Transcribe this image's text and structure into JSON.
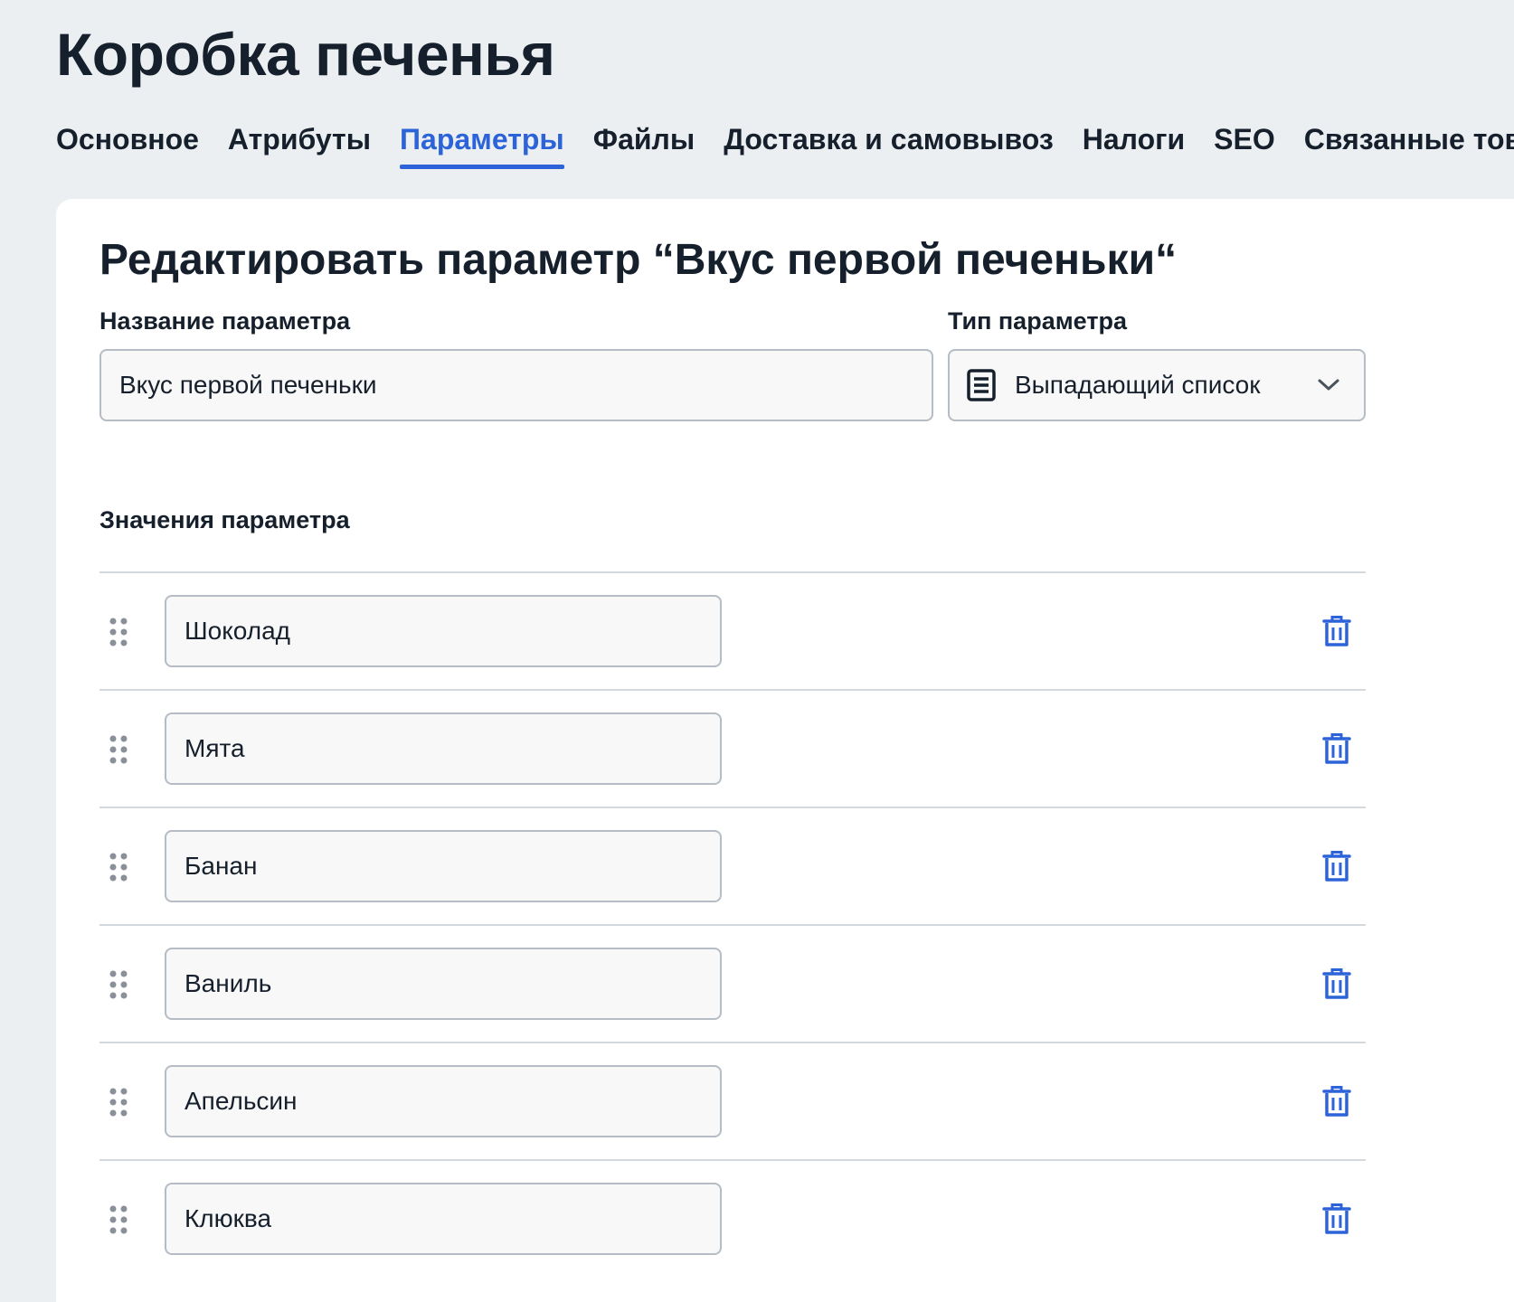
{
  "header": {
    "title": "Коробка печенья"
  },
  "tabs": [
    {
      "label": "Основное",
      "active": false
    },
    {
      "label": "Атрибуты",
      "active": false
    },
    {
      "label": "Параметры",
      "active": true
    },
    {
      "label": "Файлы",
      "active": false
    },
    {
      "label": "Доставка и самовывоз",
      "active": false
    },
    {
      "label": "Налоги",
      "active": false
    },
    {
      "label": "SEO",
      "active": false
    },
    {
      "label": "Связанные товары",
      "active": false
    }
  ],
  "form": {
    "title": "Редактировать параметр “Вкус первой печеньки“",
    "name_label": "Название параметра",
    "name_value": "Вкус первой печеньки",
    "type_label": "Тип параметра",
    "type_value": "Выпадающий список",
    "type_icon": "document-list-icon",
    "values_label": "Значения параметра",
    "values": [
      "Шоколад",
      "Мята",
      "Банан",
      "Ваниль",
      "Апельсин",
      "Клюква"
    ]
  },
  "colors": {
    "accent": "#2d63d8",
    "background": "#eceff2",
    "text": "#16202c",
    "grip": "#8a9098"
  }
}
